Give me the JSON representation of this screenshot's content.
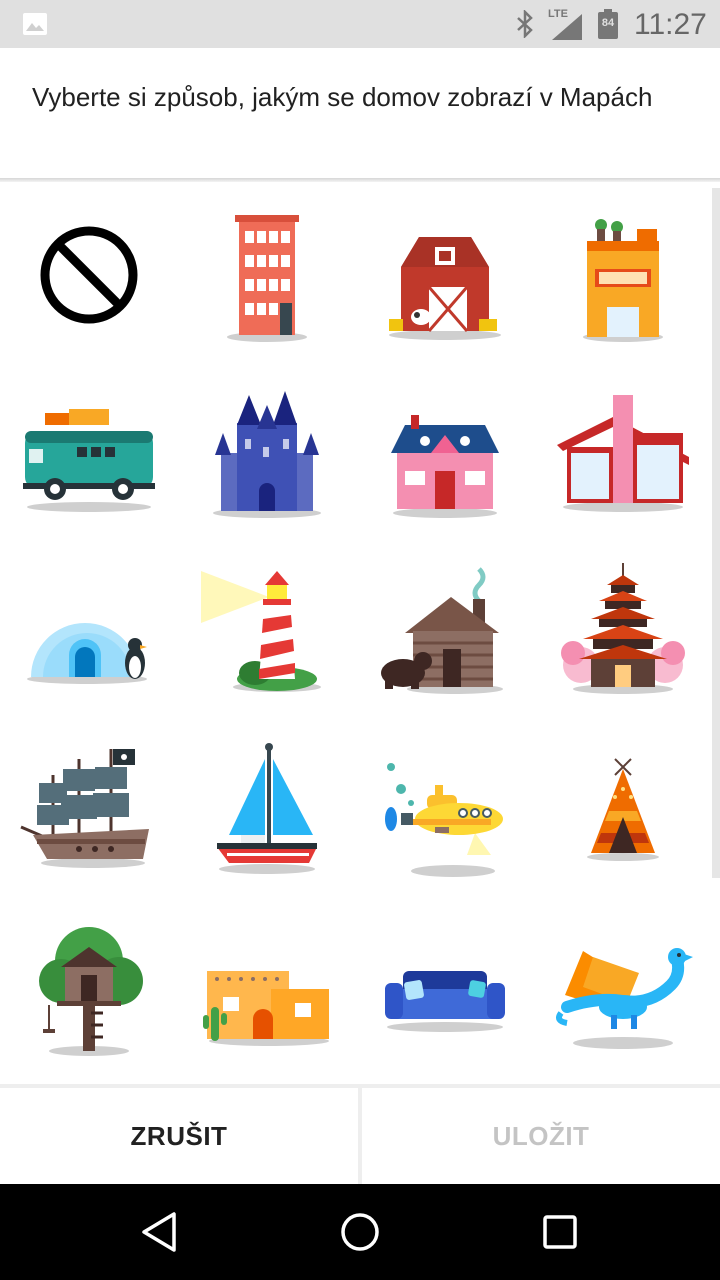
{
  "status_bar": {
    "time": "11:27",
    "network": "LTE",
    "battery": "84",
    "icons": [
      "image-icon",
      "bluetooth-icon",
      "signal-icon",
      "battery-icon"
    ]
  },
  "dialog": {
    "title": "Vyberte si způsob, jakým se domov zobrazí v Mapách"
  },
  "grid": {
    "icons": [
      "none-icon",
      "apartment-building-icon",
      "barn-icon",
      "rooftop-garden-building-icon",
      "camper-van-icon",
      "castle-icon",
      "cottage-icon",
      "modern-house-icon",
      "igloo-icon",
      "lighthouse-icon",
      "log-cabin-icon",
      "pagoda-icon",
      "pirate-ship-icon",
      "sailboat-icon",
      "submarine-icon",
      "teepee-icon",
      "treehouse-icon",
      "adobe-house-icon",
      "couch-icon",
      "dragon-icon"
    ]
  },
  "buttons": {
    "cancel_label": "ZRUŠIT",
    "save_label": "ULOŽIT",
    "save_enabled": false
  },
  "nav_bar": {
    "icons": [
      "back-icon",
      "home-icon",
      "recents-icon"
    ]
  },
  "colors": {
    "status_bar_bg": "#e0e0e0",
    "primary_text": "#212121",
    "disabled_text": "#c4c4c4",
    "nav_bar_bg": "#000000"
  }
}
